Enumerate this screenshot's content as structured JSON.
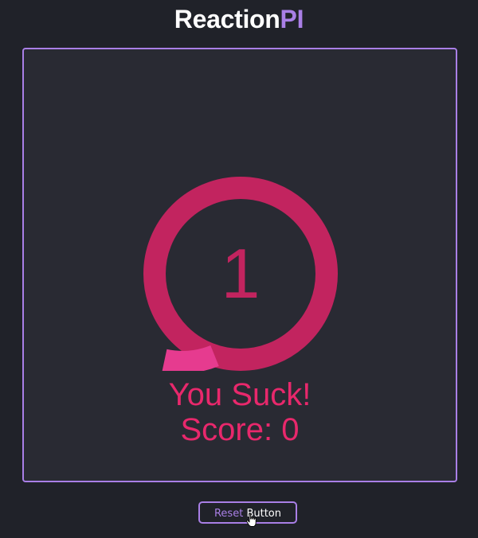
{
  "app": {
    "title_part1": "Reaction",
    "title_part2": "PI",
    "accent_color": "#a97fe6"
  },
  "game": {
    "countdown": "1",
    "message": "You Suck!",
    "score_label": "Score:",
    "score_value": "0",
    "text_color": "#e8286c",
    "ring_color": "#c2245f",
    "ring_highlight_color": "#e63b8f"
  },
  "controls": {
    "reset_word": "Reset",
    "button_word": "Button"
  },
  "icons": {
    "cursor": "hand-pointer-icon"
  }
}
